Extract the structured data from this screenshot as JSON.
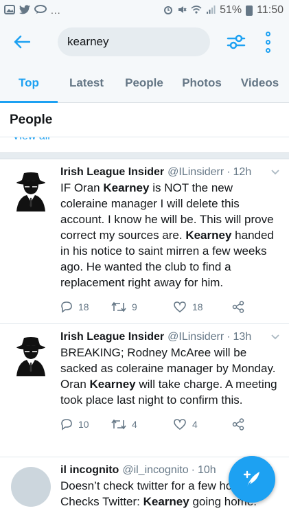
{
  "status_bar": {
    "battery": "51%",
    "time": "11:50"
  },
  "search": {
    "query": "kearney"
  },
  "tabs": [
    {
      "label": "Top",
      "active": true
    },
    {
      "label": "Latest",
      "active": false
    },
    {
      "label": "People",
      "active": false
    },
    {
      "label": "Photos",
      "active": false
    },
    {
      "label": "Videos",
      "active": false
    }
  ],
  "people_section": {
    "title": "People",
    "view_all": "View all"
  },
  "tweets": [
    {
      "name": "Irish League Insider",
      "handle": "@ILinsiderr",
      "time": "12h",
      "text_html": "IF Oran <b>Kearney</b> is NOT the new coleraine manager I will delete this account. I know he will be. This will prove correct my sources are. <b>Kearney</b> handed in his notice to saint mirren a few weeks ago. He wanted the club to find a replacement right away for him.",
      "replies": "18",
      "retweets": "9",
      "likes": "18"
    },
    {
      "name": "Irish League Insider",
      "handle": "@ILinsiderr",
      "time": "13h",
      "text_html": "BREAKING; Rodney McAree will be sacked as coleraine manager by Monday. Oran <b>Kearney</b> will take charge. A meeting took place last night to confirm this.",
      "replies": "10",
      "retweets": "4",
      "likes": "4"
    },
    {
      "name": "il incognito",
      "handle": "@il_incognito",
      "time": "10h",
      "text_html": "Doesn’t check twitter for a few ho<br>Checks Twitter: <b>Kearney</b> going home.",
      "replies": "",
      "retweets": "",
      "likes": ""
    }
  ],
  "colors": {
    "accent": "#1da1f2",
    "secondary_text": "#657786",
    "background": "#ffffff",
    "header_bg": "#f5f8fa"
  },
  "icons": {
    "back": "arrow-left-icon",
    "filter": "sliders-icon",
    "more": "vertical-dots-icon",
    "compose": "feather-plus-icon"
  }
}
